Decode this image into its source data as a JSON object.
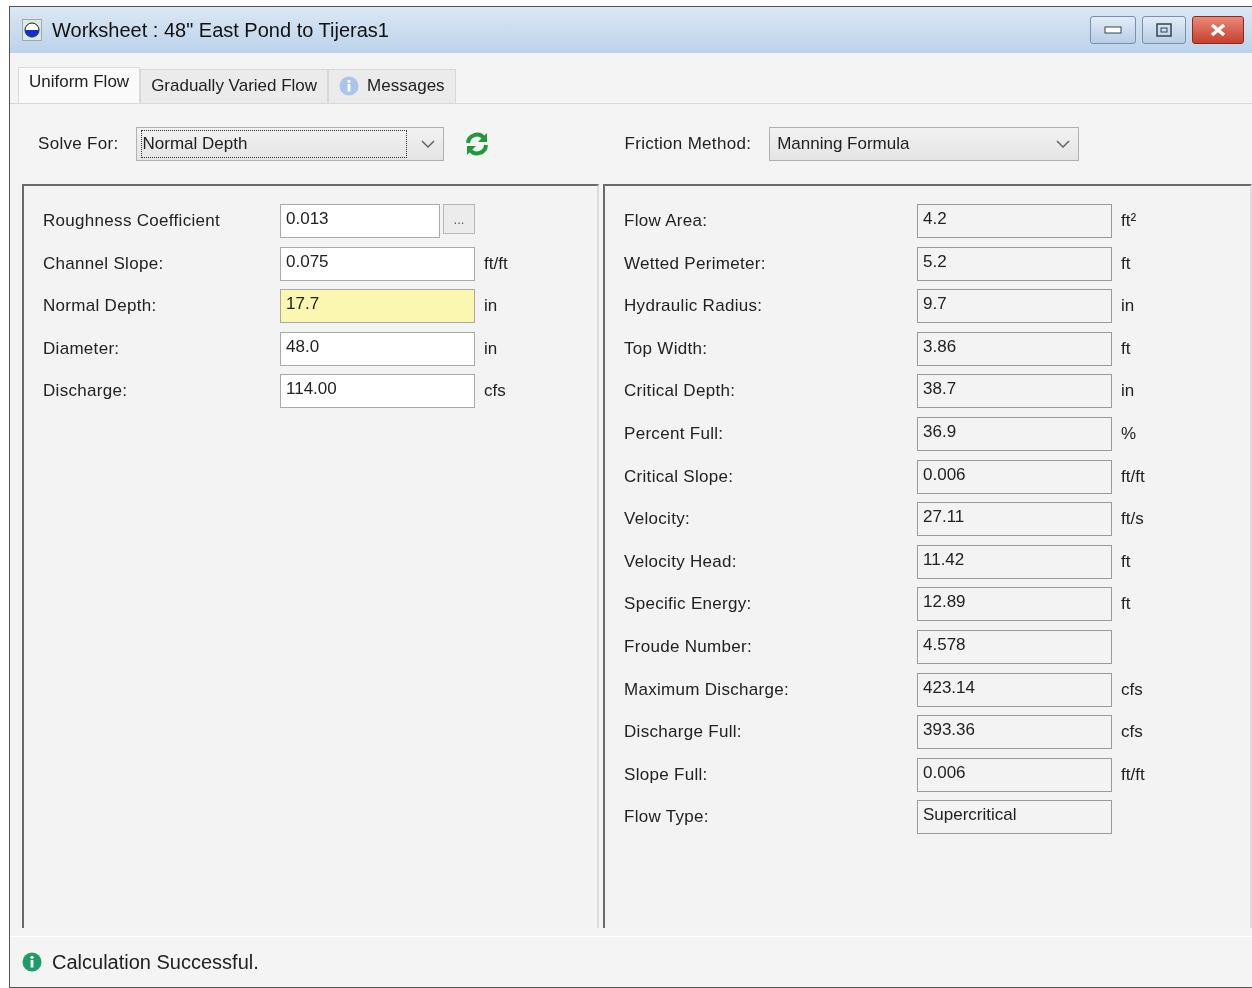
{
  "window": {
    "title": "Worksheet : 48\" East Pond to Tijeras1"
  },
  "tabs": [
    {
      "label": "Uniform Flow",
      "selected": true,
      "kind": "plain"
    },
    {
      "label": "Gradually Varied Flow",
      "selected": false,
      "kind": "plain"
    },
    {
      "label": "Messages",
      "selected": false,
      "kind": "info"
    }
  ],
  "toolbar": {
    "solve_for": {
      "label": "Solve For:",
      "value": "Normal Depth"
    },
    "friction_method": {
      "label": "Friction Method:",
      "value": "Manning Formula"
    }
  },
  "inputs": [
    {
      "label": "Roughness Coefficient",
      "value": "0.013",
      "kind": "browse",
      "button": "...",
      "highlighted": false
    },
    {
      "label": "Channel Slope:",
      "value": "0.075",
      "unit": "ft/ft",
      "kind": "plain",
      "highlighted": false
    },
    {
      "label": "Normal Depth:",
      "value": "17.7",
      "unit": "in",
      "kind": "plain",
      "highlighted": true
    },
    {
      "label": "Diameter:",
      "value": "48.0",
      "unit": "in",
      "kind": "plain",
      "highlighted": false
    },
    {
      "label": "Discharge:",
      "value": "114.00",
      "unit": "cfs",
      "kind": "plain",
      "highlighted": false
    }
  ],
  "results": [
    {
      "label": "Flow Area:",
      "value": "4.2",
      "unit": "ft²"
    },
    {
      "label": "Wetted Perimeter:",
      "value": "5.2",
      "unit": "ft"
    },
    {
      "label": "Hydraulic Radius:",
      "value": "9.7",
      "unit": "in"
    },
    {
      "label": "Top Width:",
      "value": "3.86",
      "unit": "ft"
    },
    {
      "label": "Critical Depth:",
      "value": "38.7",
      "unit": "in"
    },
    {
      "label": "Percent Full:",
      "value": "36.9",
      "unit": "%"
    },
    {
      "label": "Critical Slope:",
      "value": "0.006",
      "unit": "ft/ft"
    },
    {
      "label": "Velocity:",
      "value": "27.11",
      "unit": "ft/s"
    },
    {
      "label": "Velocity Head:",
      "value": "11.42",
      "unit": "ft"
    },
    {
      "label": "Specific Energy:",
      "value": "12.89",
      "unit": "ft"
    },
    {
      "label": "Froude Number:",
      "value": "4.578"
    },
    {
      "label": "Maximum Discharge:",
      "value": "423.14",
      "unit": "cfs"
    },
    {
      "label": "Discharge Full:",
      "value": "393.36",
      "unit": "cfs"
    },
    {
      "label": "Slope Full:",
      "value": "0.006",
      "unit": "ft/ft"
    },
    {
      "label": "Flow Type:",
      "value": "Supercritical"
    }
  ],
  "status_bar": {
    "message": "Calculation Successful."
  }
}
